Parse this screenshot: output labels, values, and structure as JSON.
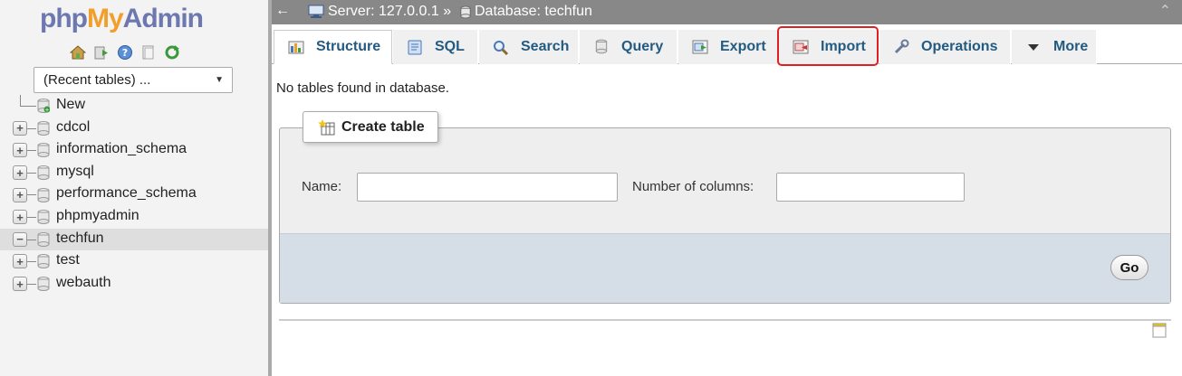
{
  "sidebar": {
    "logo": {
      "php": "php",
      "my": "My",
      "admin": "Admin"
    },
    "quick_icons": [
      "home-icon",
      "logout-icon",
      "help-icon",
      "docs-icon",
      "reload-icon"
    ],
    "recent_select": {
      "value": "(Recent tables) ..."
    },
    "tree": [
      {
        "label": "New",
        "kind": "new"
      },
      {
        "label": "cdcol",
        "kind": "db"
      },
      {
        "label": "information_schema",
        "kind": "db"
      },
      {
        "label": "mysql",
        "kind": "db"
      },
      {
        "label": "performance_schema",
        "kind": "db"
      },
      {
        "label": "phpmyadmin",
        "kind": "db"
      },
      {
        "label": "techfun",
        "kind": "db",
        "selected": true
      },
      {
        "label": "test",
        "kind": "db"
      },
      {
        "label": "webauth",
        "kind": "db"
      }
    ]
  },
  "topbar": {
    "back": "←",
    "server": "Server: 127.0.0.1 »",
    "database": "Database: techfun",
    "collapse": "⌃"
  },
  "tabs": [
    {
      "label": "Structure",
      "icon": "structure-icon",
      "active": true
    },
    {
      "label": "SQL",
      "icon": "sql-icon"
    },
    {
      "label": "Search",
      "icon": "search-icon"
    },
    {
      "label": "Query",
      "icon": "query-icon"
    },
    {
      "label": "Export",
      "icon": "export-icon"
    },
    {
      "label": "Import",
      "icon": "import-icon",
      "highlighted": true
    },
    {
      "label": "Operations",
      "icon": "wrench-icon"
    },
    {
      "label": "More",
      "icon": "caret-down-icon"
    }
  ],
  "main": {
    "no_tables": "No tables found in database.",
    "create_table": {
      "legend": "Create table",
      "name_label": "Name:",
      "name_value": "",
      "columns_label": "Number of columns:",
      "columns_value": "",
      "go_label": "Go"
    }
  },
  "colors": {
    "accent": "#235a81",
    "highlight": "#e02020",
    "topbar": "#888888"
  }
}
